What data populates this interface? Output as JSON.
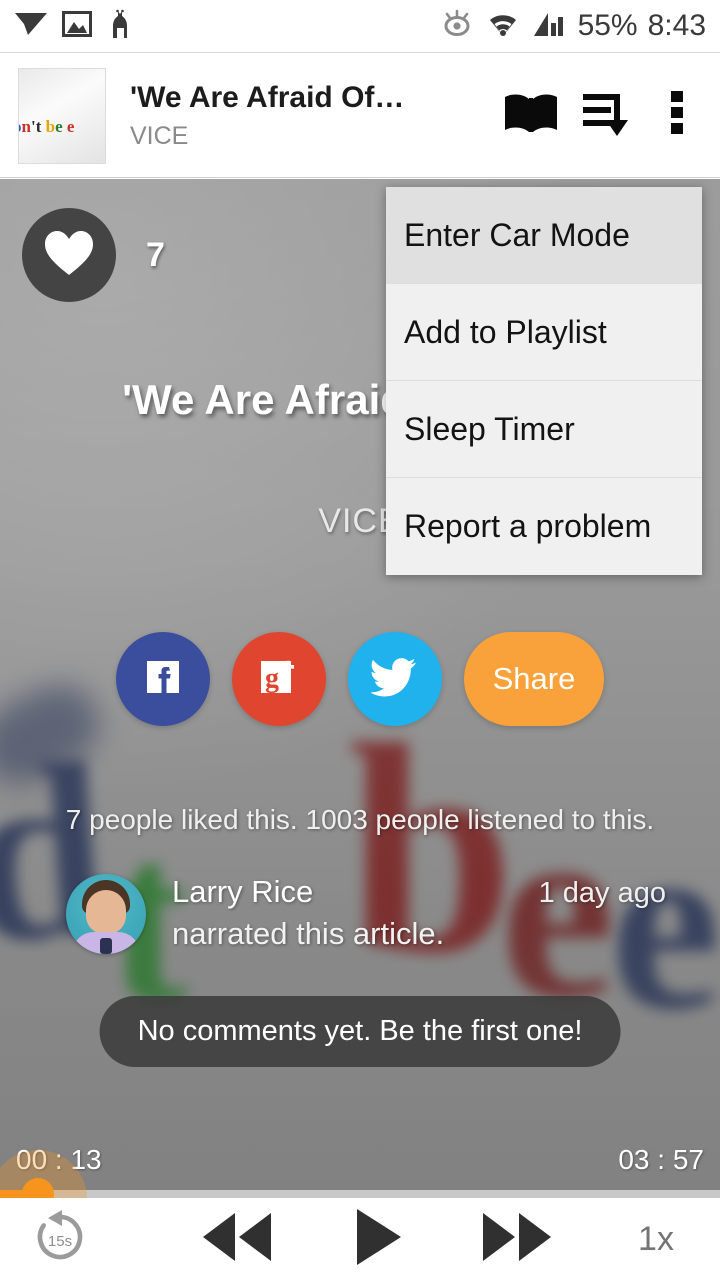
{
  "status_bar": {
    "icons_left": [
      "paper-plane-icon",
      "image-icon",
      "llama-icon"
    ],
    "icons_right": [
      "eye-icon",
      "wifi-icon",
      "signal-icon"
    ],
    "battery": "55%",
    "time": "8:43"
  },
  "app_bar": {
    "thumbnail_text": "on't be e",
    "title": "'We Are Afraid Of…",
    "subtitle": "VICE",
    "actions": [
      "book-icon",
      "playlist-download-icon",
      "overflow-icon"
    ]
  },
  "player": {
    "like_count": "7",
    "hero_title": "'We Are Afraid Of Them'",
    "hero_publisher": "VICE",
    "social": [
      {
        "name": "facebook",
        "label": "f",
        "color": "#3b4e9e"
      },
      {
        "name": "googleplus",
        "label": "g+",
        "color": "#e0452f"
      },
      {
        "name": "twitter",
        "label": "",
        "color": "#20b2ec"
      }
    ],
    "share_label": "Share",
    "share_color": "#f9a13b",
    "stats": "7 people liked this. 1003 people listened to this.",
    "narrator_name": "Larry Rice",
    "narrator_time": "1 day ago",
    "narrator_action": "narrated this article.",
    "comments": "No comments yet. Be the first one!",
    "elapsed": "00 : 13",
    "remaining": "03 : 57",
    "progress_percent": 5,
    "accent_color": "#f7941e"
  },
  "controls": {
    "rewind_label": "15s",
    "speed_label": "1x",
    "buttons": [
      "rewind-15-icon",
      "previous-icon",
      "play-icon",
      "next-icon"
    ]
  },
  "overflow_menu": {
    "items": [
      {
        "label": "Enter Car Mode",
        "highlighted": true
      },
      {
        "label": "Add to Playlist",
        "highlighted": false
      },
      {
        "label": "Sleep Timer",
        "highlighted": false
      },
      {
        "label": "Report a problem",
        "highlighted": false
      }
    ]
  }
}
